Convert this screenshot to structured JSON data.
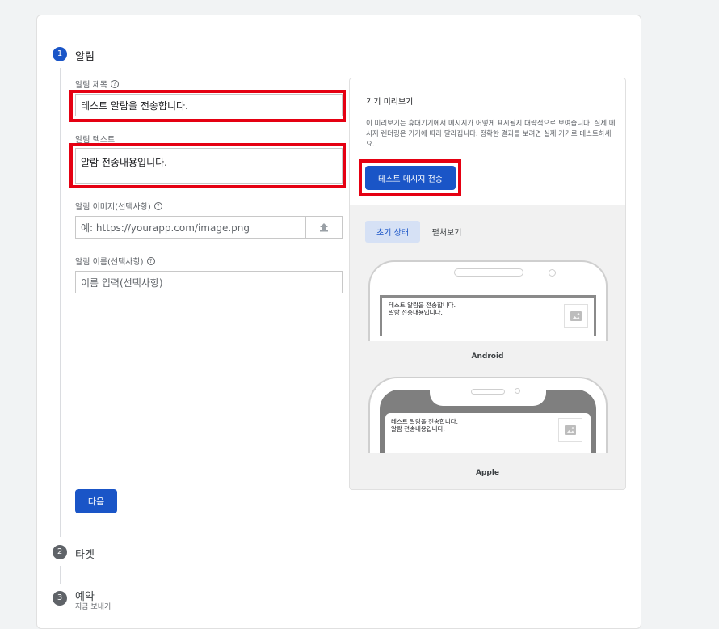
{
  "steps": [
    {
      "number": "1",
      "title": "알림"
    },
    {
      "number": "2",
      "title": "타겟"
    },
    {
      "number": "3",
      "title": "예약",
      "subtitle": "지금 보내기"
    }
  ],
  "form": {
    "title_label": "알림 제목",
    "title_value": "테스트 알람을 전송합니다.",
    "text_label": "알림 텍스트",
    "text_value": "알람 전송내용입니다.",
    "image_label": "알림 이미지(선택사항)",
    "image_placeholder": "예: https://yourapp.com/image.png",
    "name_label": "알림 이름(선택사항)",
    "name_placeholder": "이름 입력(선택사항)",
    "next_label": "다음",
    "help_glyph": "?"
  },
  "preview": {
    "title": "기기 미리보기",
    "description": "이 미리보기는 휴대기기에서 메시지가 어떻게 표시될지 대략적으로 보여줍니다. 실제 메시지 렌더링은 기기에 따라 달라집니다. 정확한 결과를 보려면 실제 기기로 테스트하세요.",
    "send_button": "테스트 메시지 전송",
    "tabs": [
      "초기 상태",
      "펼처보기"
    ],
    "notification_title": "테스트 알람을 전송합니다.",
    "notification_body": "알람 전송내용입니다.",
    "android_label": "Android",
    "apple_label": "Apple"
  },
  "colors": {
    "accent": "#1a55c7",
    "highlight": "#e50012"
  }
}
